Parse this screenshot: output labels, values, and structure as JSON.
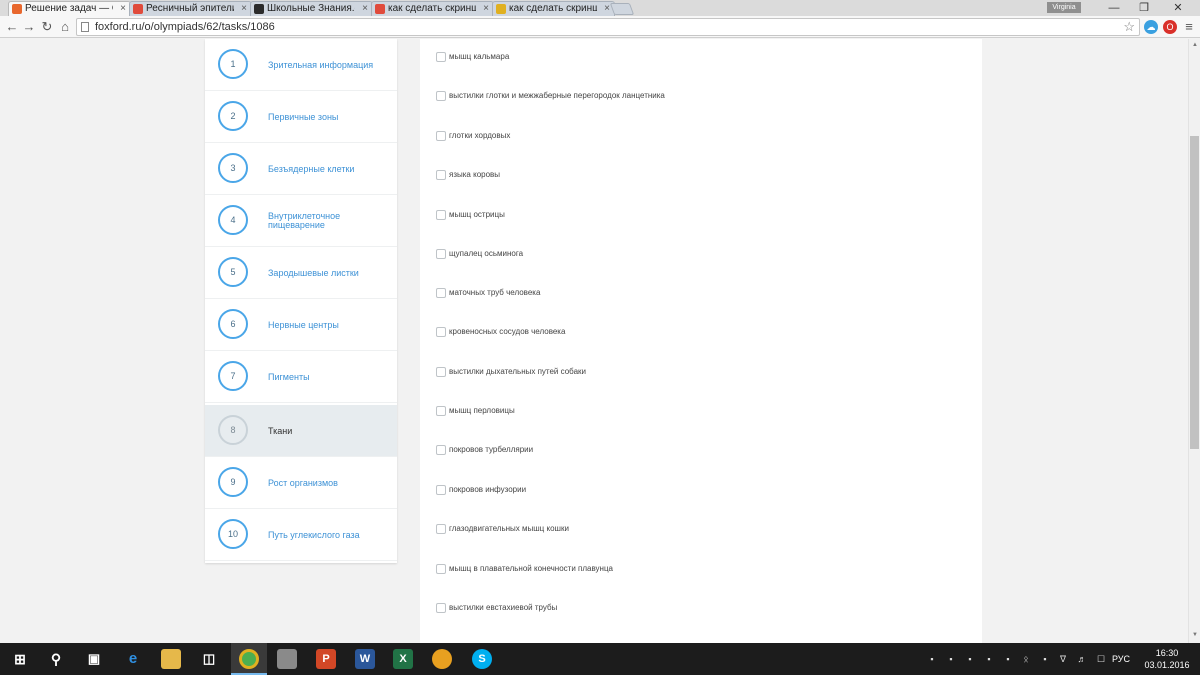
{
  "browser": {
    "tabs": [
      {
        "title": "Решение задач — О",
        "favicon_color": "#e8672d",
        "active": true
      },
      {
        "title": "Ресничный эпители",
        "favicon_color": "#e04b3c",
        "active": false
      },
      {
        "title": "Школьные Знания.с",
        "favicon_color": "#2b2b2b",
        "active": false
      },
      {
        "title": "как сделать скринш",
        "favicon_color": "#e04b3c",
        "active": false
      },
      {
        "title": "как сделать скринш",
        "favicon_color": "#e0b020",
        "active": false
      }
    ],
    "url": "foxford.ru/o/olympiads/62/tasks/1086",
    "profile_name": "Virginia"
  },
  "sidebar": {
    "items": [
      {
        "number": "1",
        "label": "Зрительная информация",
        "active": false
      },
      {
        "number": "2",
        "label": "Первичные зоны",
        "active": false
      },
      {
        "number": "3",
        "label": "Безъядерные клетки",
        "active": false
      },
      {
        "number": "4",
        "label": "Внутриклеточное пищеварение",
        "active": false
      },
      {
        "number": "5",
        "label": "Зародышевые листки",
        "active": false
      },
      {
        "number": "6",
        "label": "Нервные центры",
        "active": false
      },
      {
        "number": "7",
        "label": "Пигменты",
        "active": false
      },
      {
        "number": "8",
        "label": "Ткани",
        "active": true
      },
      {
        "number": "9",
        "label": "Рост организмов",
        "active": false
      },
      {
        "number": "10",
        "label": "Путь углекислого газа",
        "active": false
      }
    ]
  },
  "answers": [
    {
      "label": "мышц кальмара",
      "checked": false
    },
    {
      "label": "выстилки глотки и межжаберные перегородок ланцетника",
      "checked": false
    },
    {
      "label": "глотки хордовых",
      "checked": false
    },
    {
      "label": "языка коровы",
      "checked": false
    },
    {
      "label": "мышц острицы",
      "checked": false
    },
    {
      "label": "щупалец осьминога",
      "checked": false
    },
    {
      "label": "маточных труб человека",
      "checked": false
    },
    {
      "label": "кровеносных сосудов человека",
      "checked": false
    },
    {
      "label": "выстилки дыхательных путей собаки",
      "checked": false
    },
    {
      "label": "мышц перловицы",
      "checked": false
    },
    {
      "label": "покровов турбеллярии",
      "checked": false
    },
    {
      "label": "покровов инфузории",
      "checked": false
    },
    {
      "label": "глазодвигательных мышц кошки",
      "checked": false
    },
    {
      "label": "мышц в плавательной конечности плавунца",
      "checked": false
    },
    {
      "label": "выстилки евстахиевой трубы",
      "checked": false
    }
  ],
  "taskbar": {
    "language": "РУС",
    "time": "16:30",
    "date": "03.01.2016"
  },
  "colors": {
    "accent": "#4aa6e8",
    "link": "#3e92d6",
    "active_bg": "#e7ecef"
  }
}
